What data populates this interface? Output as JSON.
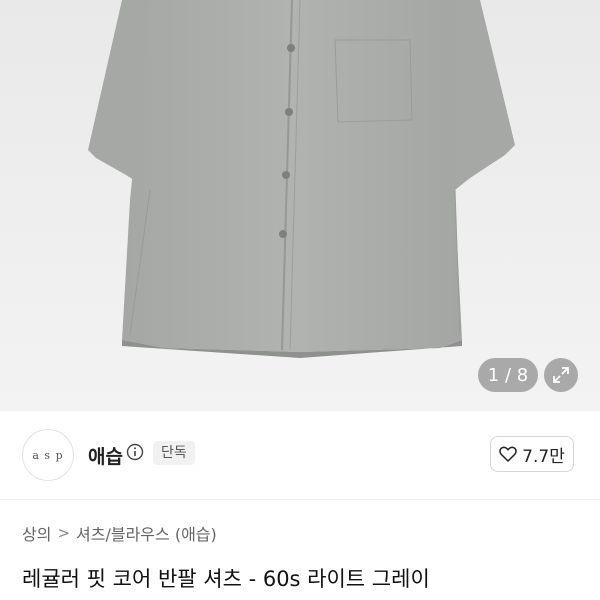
{
  "gallery": {
    "counter": "1 / 8",
    "expand_icon": "expand-icon"
  },
  "seller": {
    "avatar_text": "a s p",
    "name": "애습",
    "info_icon": "info-icon",
    "badge": "단독"
  },
  "like": {
    "icon": "heart-icon",
    "count": "7.7만"
  },
  "breadcrumb": {
    "items": [
      "상의",
      "셔츠/블라우스 (애습)"
    ],
    "separator": ">"
  },
  "product": {
    "title": "레귤러 핏 코어 반팔 셔츠 - 60s 라이트 그레이"
  },
  "colors": {
    "shirt": "#a7aaa7",
    "background": "#ececec",
    "text": "#111111"
  }
}
